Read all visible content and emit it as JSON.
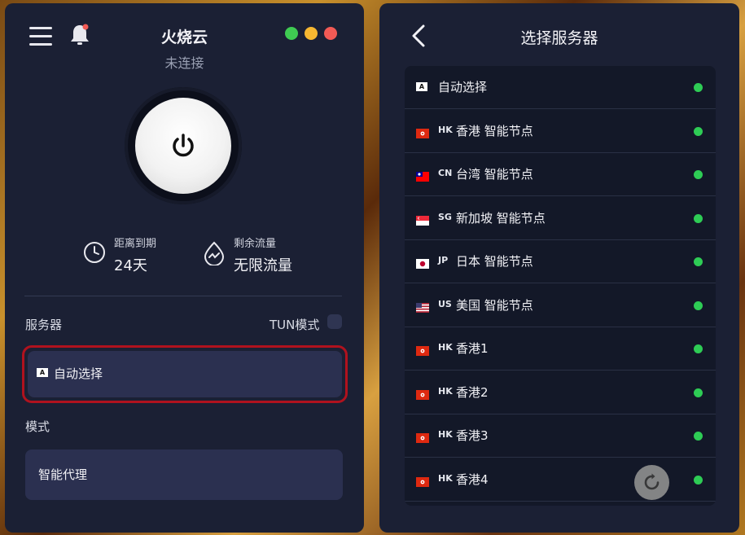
{
  "left_panel": {
    "app_title": "火烧云",
    "connection_status": "未连接",
    "window_controls": {
      "colors": [
        "#3fcb52",
        "#f7b731",
        "#f25a55"
      ]
    },
    "stats": {
      "expiry_label": "距离到期",
      "expiry_value": "24天",
      "traffic_label": "剩余流量",
      "traffic_value": "无限流量"
    },
    "server_label": "服务器",
    "tun_label": "TUN模式",
    "selected_server": {
      "badge": "A",
      "name": "自动选择"
    },
    "mode_label": "模式",
    "mode_value": "智能代理"
  },
  "right_panel": {
    "title": "选择服务器",
    "servers": [
      {
        "icon": "auto-badge",
        "badge": "A",
        "code": "",
        "name": "自动选择",
        "status_color": "#2ecc55"
      },
      {
        "icon": "hk-flag",
        "code": "HK",
        "name": "香港 智能节点",
        "status_color": "#2ecc55"
      },
      {
        "icon": "tw-flag",
        "code": "CN",
        "name": "台湾 智能节点",
        "status_color": "#2ecc55"
      },
      {
        "icon": "sg-flag",
        "code": "SG",
        "name": "新加坡 智能节点",
        "status_color": "#2ecc55"
      },
      {
        "icon": "jp-flag",
        "code": "JP",
        "name": "日本 智能节点",
        "status_color": "#2ecc55"
      },
      {
        "icon": "us-flag",
        "code": "US",
        "name": "美国 智能节点",
        "status_color": "#2ecc55"
      },
      {
        "icon": "hk-flag",
        "code": "HK",
        "name": "香港1",
        "status_color": "#2ecc55"
      },
      {
        "icon": "hk-flag",
        "code": "HK",
        "name": "香港2",
        "status_color": "#2ecc55"
      },
      {
        "icon": "hk-flag",
        "code": "HK",
        "name": "香港3",
        "status_color": "#2ecc55"
      },
      {
        "icon": "hk-flag",
        "code": "HK",
        "name": "香港4",
        "status_color": "#2ecc55"
      }
    ]
  },
  "colors": {
    "panel_bg": "#1b2034",
    "accent_red": "#b0121e",
    "online": "#2ecc55"
  }
}
